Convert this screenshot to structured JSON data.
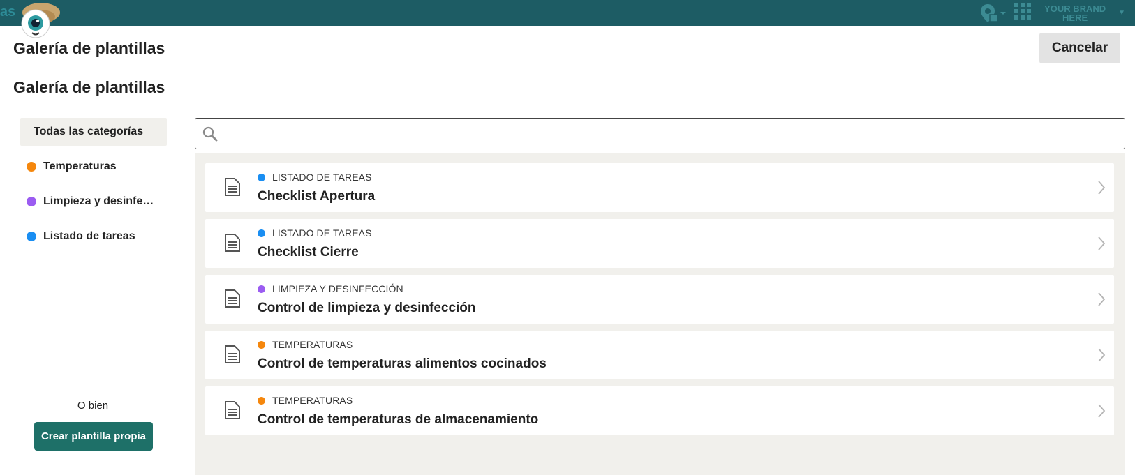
{
  "topbar": {
    "partial_text": "as",
    "brand_text": "YOUR BRAND HERE",
    "icons": [
      "mascot-logo",
      "location-pin-icon",
      "apps-grid-icon"
    ]
  },
  "modal": {
    "title": "Galería de plantillas",
    "cancel_label": "Cancelar",
    "section_title": "Galería de plantillas"
  },
  "colors": {
    "topbar": "#1d5c64",
    "accent": "#1e7068",
    "orange": "#f5870d",
    "purple": "#9b5cf1",
    "blue": "#1a8ef2"
  },
  "sidebar": {
    "categories": [
      {
        "label": "Todas las categorías",
        "color": null,
        "active": true
      },
      {
        "label": "Temperaturas",
        "color": "#f5870d"
      },
      {
        "label": "Limpieza y desinfe…",
        "color": "#9b5cf1"
      },
      {
        "label": "Listado de tareas",
        "color": "#1a8ef2"
      }
    ],
    "or_text": "O bien",
    "create_label": "Crear plantilla propia"
  },
  "search": {
    "value": "",
    "placeholder": ""
  },
  "templates": [
    {
      "category": "LISTADO DE TAREAS",
      "color": "#1a8ef2",
      "name": "Checklist Apertura"
    },
    {
      "category": "LISTADO DE TAREAS",
      "color": "#1a8ef2",
      "name": "Checklist Cierre"
    },
    {
      "category": "LIMPIEZA Y DESINFECCIÓN",
      "color": "#9b5cf1",
      "name": "Control de limpieza y desinfección"
    },
    {
      "category": "TEMPERATURAS",
      "color": "#f5870d",
      "name": "Control de temperaturas alimentos cocinados"
    },
    {
      "category": "TEMPERATURAS",
      "color": "#f5870d",
      "name": "Control de temperaturas de almacenamiento"
    }
  ]
}
